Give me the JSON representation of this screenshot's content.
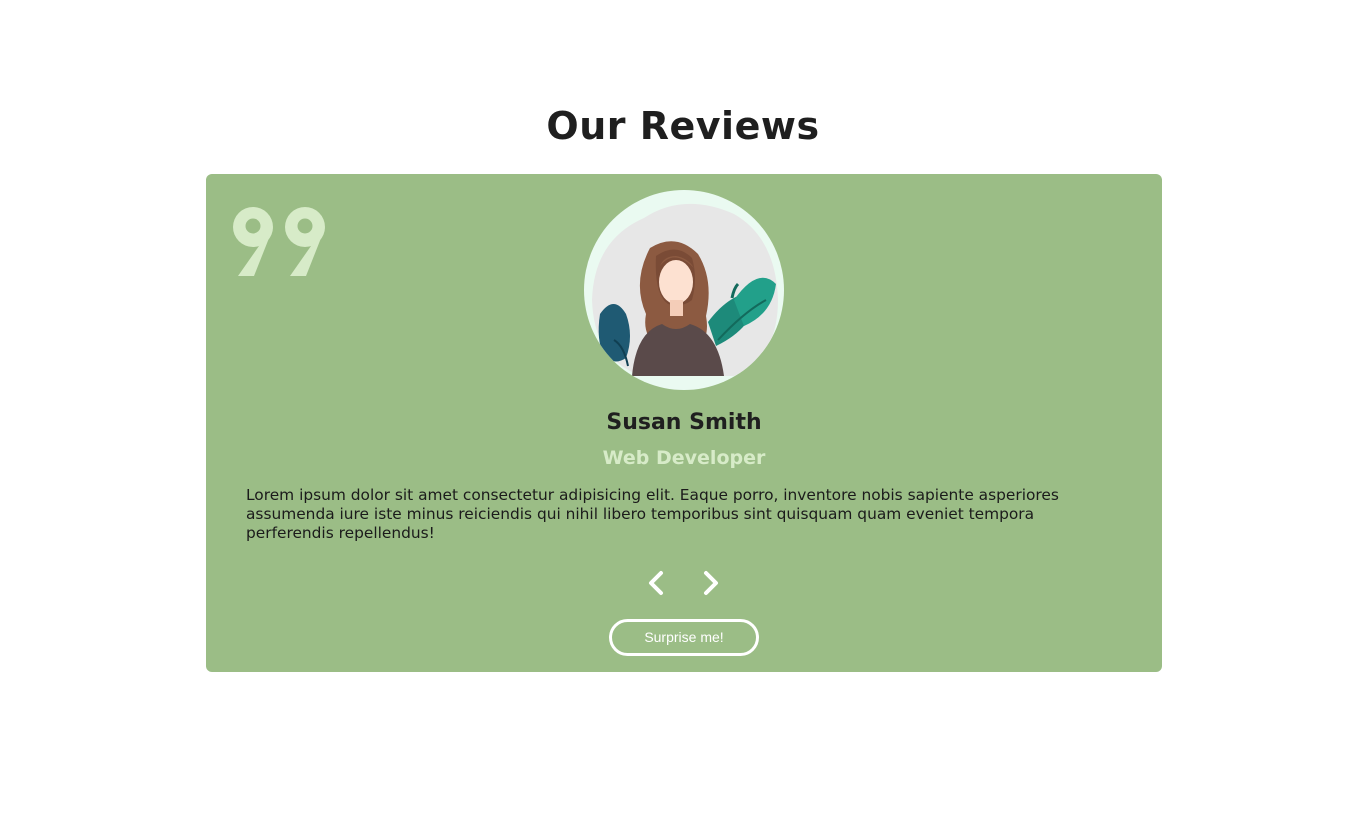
{
  "section": {
    "title": "Our Reviews"
  },
  "review": {
    "name": "Susan Smith",
    "job": "Web Developer",
    "text": "Lorem ipsum dolor sit amet consectetur adipisicing elit. Eaque porro, inventore nobis sapiente asperiores assumenda iure iste minus reiciendis qui nihil libero temporibus sint quisquam quam eveniet tempora perferendis repellendus!",
    "avatar_icon": "woman-portrait-avatar"
  },
  "controls": {
    "prev_icon": "chevron-left-icon",
    "next_icon": "chevron-right-icon",
    "random_label": "Surprise me!"
  },
  "colors": {
    "card_background": "#9bbd86",
    "quote_mark": "#d7ebc8",
    "job_title": "#d7ebc8",
    "avatar_ring": "#eafaf1",
    "button_outline": "#ffffff"
  }
}
